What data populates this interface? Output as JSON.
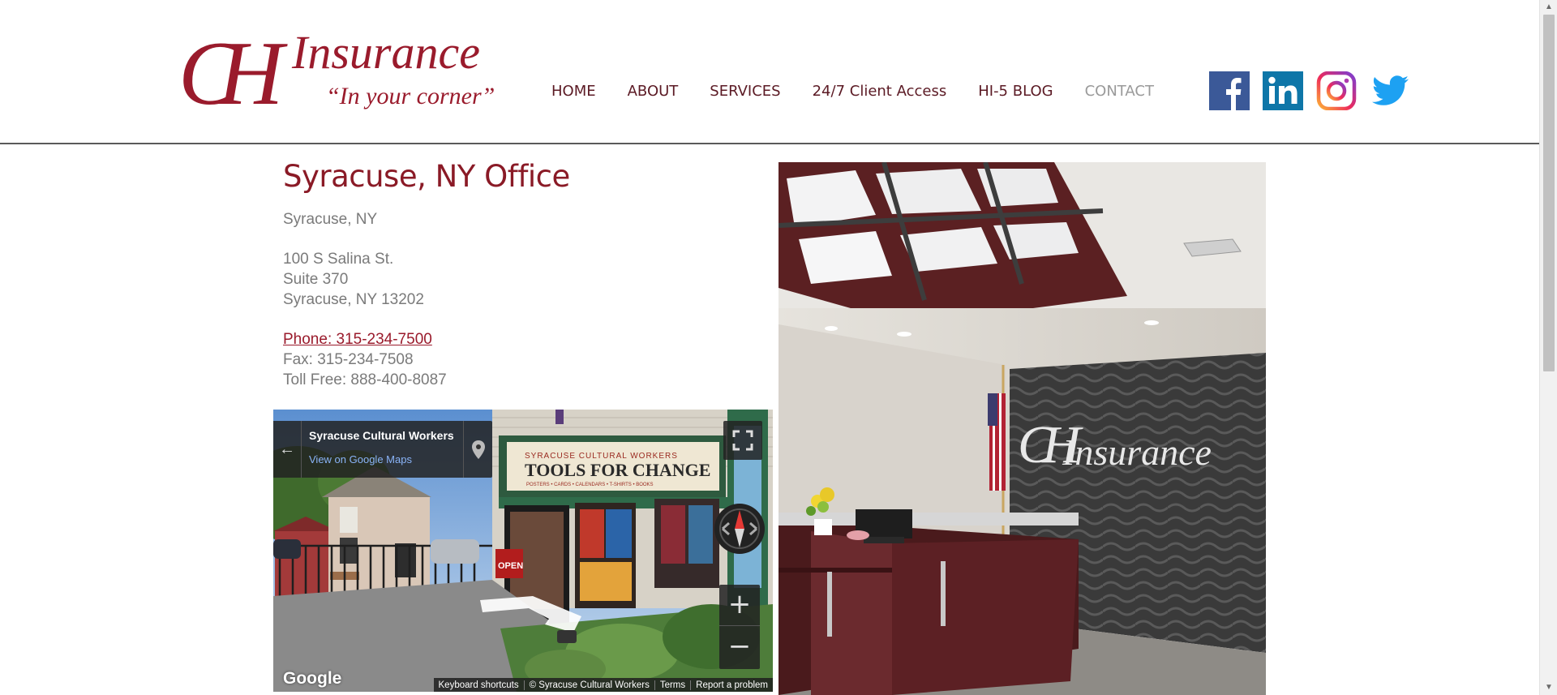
{
  "brand": {
    "logo_monogram": "CH",
    "logo_word": "Insurance",
    "tagline": "“In your corner”",
    "color": "#9a1b2c"
  },
  "nav": {
    "items": [
      {
        "label": "HOME"
      },
      {
        "label": "ABOUT"
      },
      {
        "label": "SERVICES"
      },
      {
        "label": "24/7 Client Access"
      },
      {
        "label": "HI-5 BLOG"
      },
      {
        "label": "CONTACT",
        "active": true
      }
    ]
  },
  "social": [
    "facebook-icon",
    "linkedin-icon",
    "instagram-icon",
    "twitter-icon"
  ],
  "office": {
    "title": "Syracuse, NY Office",
    "city": "Syracuse, NY",
    "address_line1": "100 S Salina St.",
    "address_line2": "Suite 370",
    "address_line3": "Syracuse, NY 13202",
    "phone": "Phone: 315-234-7500",
    "fax": "Fax: 315-234-7508",
    "tollfree": "Toll Free: 888-400-8087"
  },
  "streetview": {
    "place_name": "Syracuse Cultural Workers",
    "link": "View on Google Maps",
    "store_sign_small": "SYRACUSE CULTURAL WORKERS",
    "store_sign": "TOOLS FOR CHANGE",
    "store_sign_sub": "POSTERS • CARDS • CALENDARS • T-SHIRTS • BOOKS",
    "open_sign": "OPEN",
    "google": "Google",
    "footer": [
      "Keyboard shortcuts",
      "© Syracuse Cultural Workers",
      "Terms",
      "Report a problem"
    ]
  },
  "photo": {
    "wall_monogram": "CH",
    "wall_text": "Insurance"
  }
}
